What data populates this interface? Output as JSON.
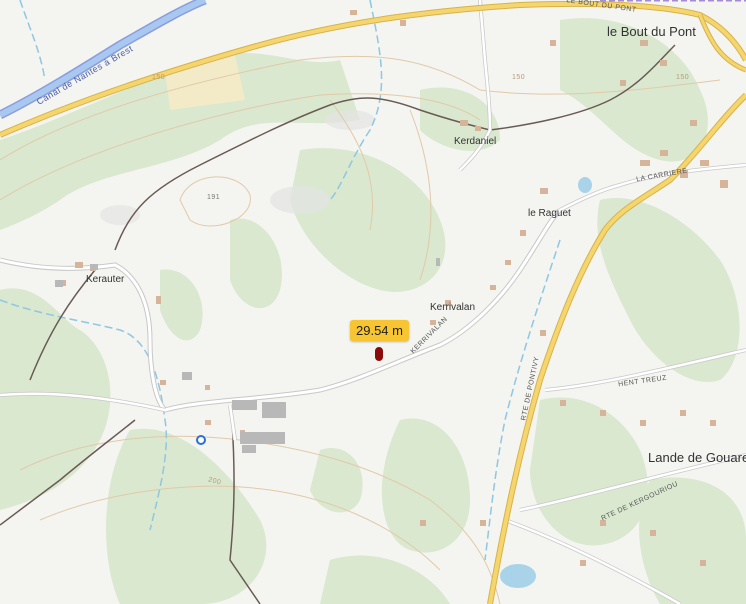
{
  "map": {
    "places": {
      "le_bout_du_pont": "le Bout du Pont",
      "kerdaniel": "Kerdaniel",
      "le_raguet": "le Raguet",
      "kerauter": "Kerauter",
      "kerrivalan": "Kerrivalan",
      "lande_de_gouarec": "Lande de Gouarec"
    },
    "road_labels": {
      "bout_du_pont_road": "LE BOUT DU PONT",
      "la_carriere": "LA CARRIERE",
      "kerrivalan_road": "KERRIVALAN",
      "rte_de_pontivy": "RTE DE PONTIVY",
      "hent_treuz": "HENT TREUZ",
      "rte_de_kergourio": "RTE DE KERGOURIOU"
    },
    "canal_label": "Canal de Nantes à Brest",
    "contour_labels": [
      "150",
      "150",
      "150",
      "191",
      "200"
    ],
    "measurement": "29.54 m",
    "colors": {
      "background": "#f4f4f0",
      "woods": "#d9e8cf",
      "water": "#a9d3e8",
      "main_road": "#f5d56e",
      "track": "#6a5a55",
      "contour": "#e2c9a8",
      "building": "#d6b49a",
      "measure_badge": "#f7c531",
      "marker": "#8b0b0b"
    }
  }
}
